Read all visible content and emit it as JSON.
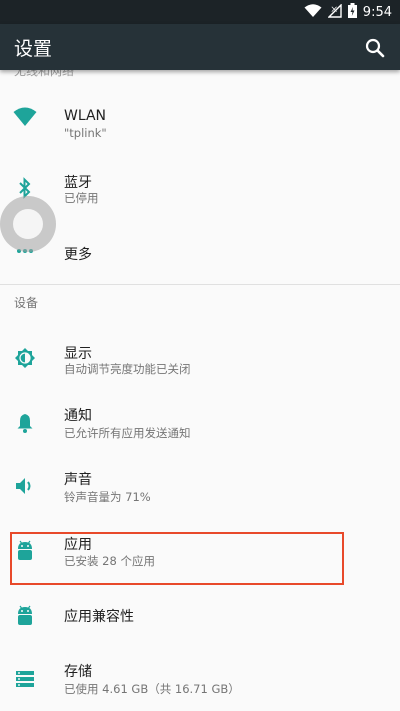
{
  "status_bar": {
    "time": "9:54"
  },
  "app_bar": {
    "title": "设置"
  },
  "partial_header": "无线和网络",
  "items": [
    {
      "name": "wlan",
      "title": "WLAN",
      "subtitle": "\"tplink\""
    },
    {
      "name": "bluetooth",
      "title": "蓝牙",
      "subtitle": "已停用"
    },
    {
      "name": "more",
      "title": "更多",
      "subtitle": ""
    }
  ],
  "device_section": {
    "label": "设备",
    "items": [
      {
        "name": "display",
        "title": "显示",
        "subtitle": "自动调节亮度功能已关闭"
      },
      {
        "name": "notifications",
        "title": "通知",
        "subtitle": "已允许所有应用发送通知"
      },
      {
        "name": "sound",
        "title": "声音",
        "subtitle": "铃声音量为 71%"
      },
      {
        "name": "apps",
        "title": "应用",
        "subtitle": "已安装 28 个应用"
      },
      {
        "name": "app-compat",
        "title": "应用兼容性",
        "subtitle": ""
      },
      {
        "name": "storage",
        "title": "存储",
        "subtitle": "已使用 4.61 GB（共 16.71 GB）"
      }
    ]
  },
  "colors": {
    "accent": "#1ea49a",
    "app_bar": "#263238",
    "status_bar": "#1c2327",
    "highlight": "#e8492a"
  },
  "icons": [
    "wifi-icon",
    "signal-icon",
    "battery-icon",
    "search-icon",
    "bluetooth-icon",
    "more-icon",
    "brightness-icon",
    "bell-icon",
    "volume-icon",
    "android-icon",
    "storage-icon"
  ]
}
